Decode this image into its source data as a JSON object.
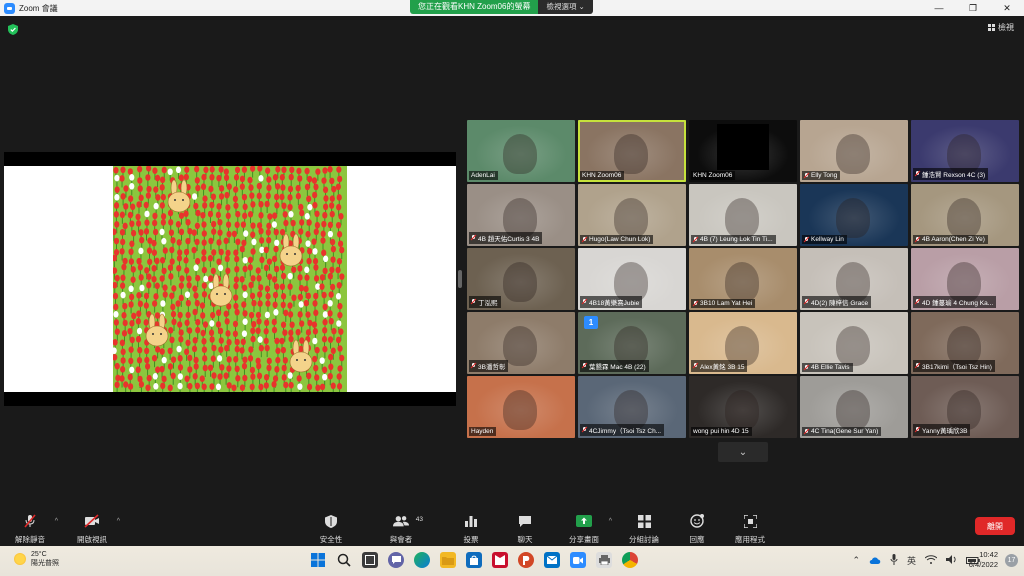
{
  "window": {
    "title": "Zoom 會議",
    "minimize": "—",
    "restore": "❐",
    "close": "✕"
  },
  "banner": {
    "text": "您正在觀看KHN Zoom06的螢幕",
    "options": "檢視選項 ⌄"
  },
  "view_button": "檢視",
  "participants": [
    {
      "name": "AdenLai",
      "muted": false,
      "bg": "#5c8a6a"
    },
    {
      "name": "KHN Zoom06",
      "muted": false,
      "bg": "#8a7462",
      "active": true
    },
    {
      "name": "KHN Zoom06",
      "muted": false,
      "bg": "#0d0d0d",
      "blackcard": true
    },
    {
      "name": "Elly Tong",
      "muted": true,
      "bg": "#b7a591"
    },
    {
      "name": "鍾浩賢 Rexson 4C (3)",
      "muted": true,
      "bg": "#3b3a6e"
    },
    {
      "name": "4B 趙天佑Curtis 3 4B",
      "muted": true,
      "bg": "#9a8f86"
    },
    {
      "name": "Hugo(Law Chun Lok)",
      "muted": true,
      "bg": "#b0a28c"
    },
    {
      "name": "4B (7) Leung Lok Tin Ti...",
      "muted": true,
      "bg": "#c9c6bf"
    },
    {
      "name": "Kellway Lin",
      "muted": true,
      "bg": "#1a3657"
    },
    {
      "name": "4B Aaron(Chen Zi Ye)",
      "muted": true,
      "bg": "#a5977f"
    },
    {
      "name": "丁泓熙",
      "muted": true,
      "bg": "#6d6151"
    },
    {
      "name": "4B18黃樂熹Jubie",
      "muted": true,
      "bg": "#d8d6d3"
    },
    {
      "name": "3B10 Lam Yat Hei",
      "muted": true,
      "bg": "#a88d6c"
    },
    {
      "name": "4D(2) 陳梓信 Grace",
      "muted": true,
      "bg": "#c5bfb8"
    },
    {
      "name": "4D 鍾蔓瑜 4 Chung Ka...",
      "muted": true,
      "bg": "#b99ea6"
    },
    {
      "name": "3B潘哲彰",
      "muted": true,
      "bg": "#8e7c6a"
    },
    {
      "name": "葉懇霖 Mac 4B (22)",
      "muted": true,
      "bg": "#5d6b5a",
      "badge": "1"
    },
    {
      "name": "Alex黃銘 3B 15",
      "muted": true,
      "bg": "#d9b98e"
    },
    {
      "name": "4B Ellie Tavis",
      "muted": true,
      "bg": "#c8c3bb"
    },
    {
      "name": "3B17kimi（Tsoi Tsz Hin)",
      "muted": true,
      "bg": "#7f6a5b"
    },
    {
      "name": "Hayden",
      "muted": false,
      "bg": "#c6714b"
    },
    {
      "name": "4CJimmy（Tsoi Tsz Ch...",
      "muted": true,
      "bg": "#5a6777"
    },
    {
      "name": "wong pui hin 4D 15",
      "muted": false,
      "bg": "#2e2a28"
    },
    {
      "name": "4C Tina(Gene Sur Yan)",
      "muted": true,
      "bg": "#9e9c98"
    },
    {
      "name": "Yanny黃瑀欣3B",
      "muted": true,
      "bg": "#6e5c55"
    }
  ],
  "toolbar": {
    "unmute": "解除靜音",
    "start_video": "開啟視訊",
    "security": "安全性",
    "participants": "與會者",
    "participant_count": "43",
    "polls": "投票",
    "chat": "聊天",
    "share_screen": "分享畫面",
    "breakout": "分組討論",
    "reactions": "回應",
    "apps": "應用程式",
    "leave": "離開",
    "share_color": "#22a04b",
    "leave_color": "#e02828"
  },
  "taskbar": {
    "temperature": "25°C",
    "weather": "陽光普照",
    "time": "10:42",
    "date": "6/4/2022",
    "ime": "英",
    "notifications": "17"
  }
}
